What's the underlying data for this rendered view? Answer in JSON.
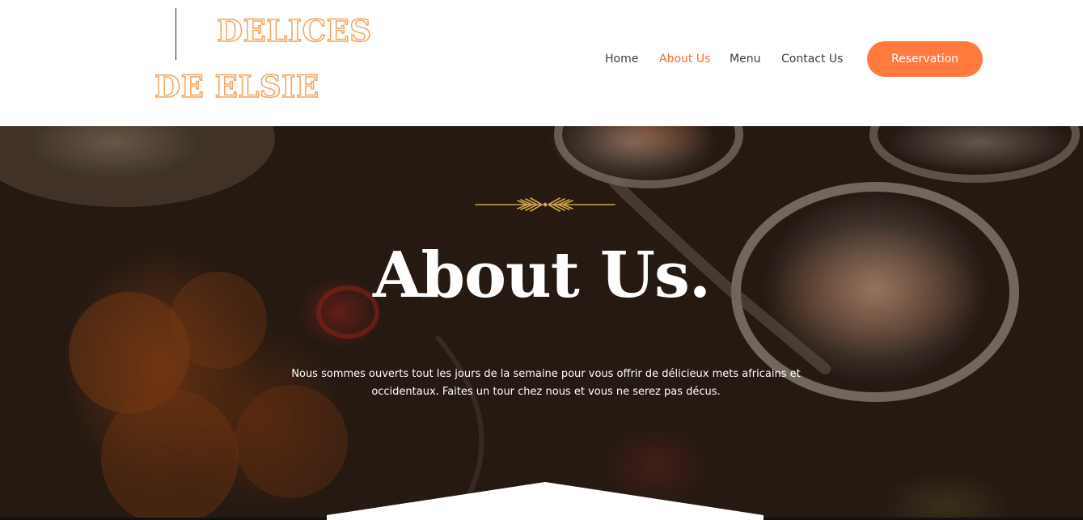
{
  "brand": {
    "line1": "DELICES",
    "line2": "DE ELSIE",
    "color": "#f3a55c"
  },
  "nav": {
    "items": [
      {
        "label": "Home"
      },
      {
        "label": "About Us",
        "active": true
      },
      {
        "label": "Menu"
      },
      {
        "label": "Contact Us"
      }
    ],
    "cta_label": "Reservation",
    "accent_color": "#ff7a3c",
    "active_color": "#ff6a2b"
  },
  "hero": {
    "title": "About Us.",
    "text": "Nous sommes ouverts tout les jours de la semaine pour vous offrir de délicieux mets africains et occidentaux. Faites un tour chez nous et vous ne serez pas décus.",
    "ornament_icon": "wheat-divider-icon",
    "ornament_color": "#d4a64a"
  }
}
